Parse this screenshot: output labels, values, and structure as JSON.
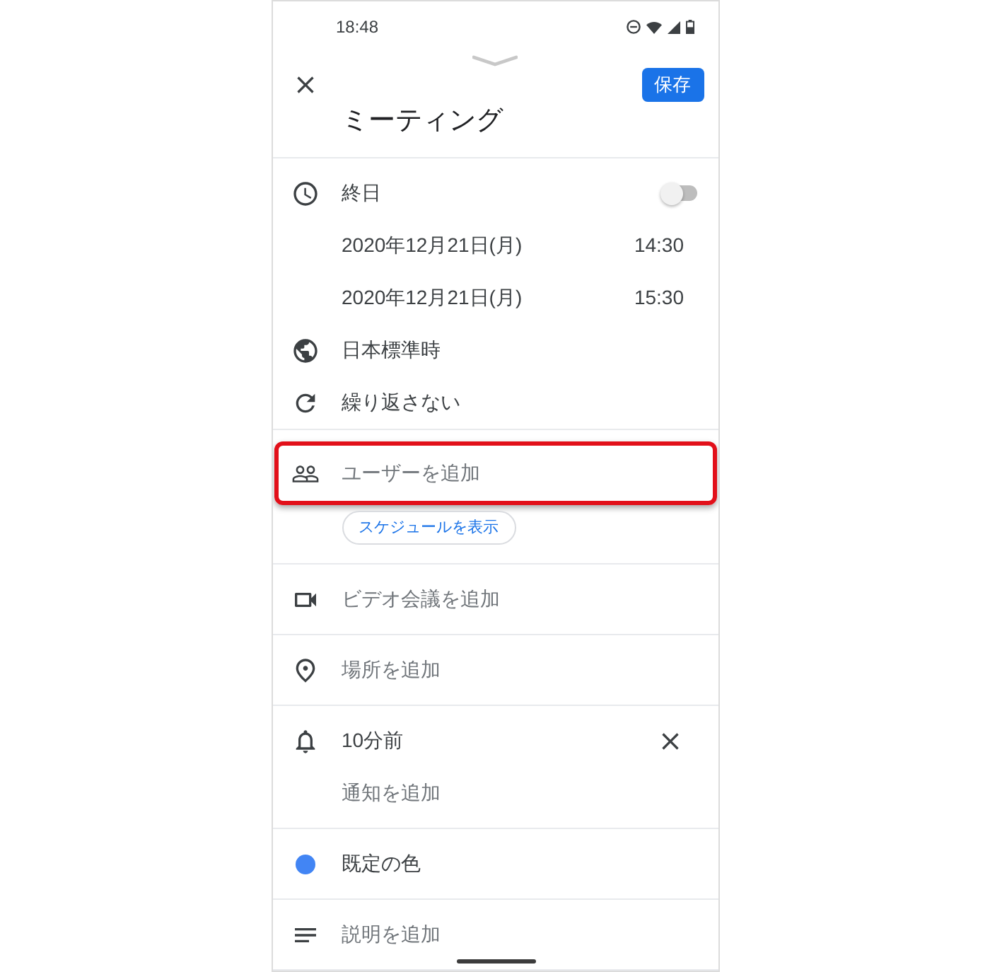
{
  "status_bar": {
    "time": "18:48"
  },
  "header": {
    "save_button": "保存",
    "title": "ミーティング"
  },
  "sections": [
    {
      "rows": [
        {
          "kind": "all_day",
          "label": "終日",
          "on": false,
          "highlighted": false
        },
        {
          "kind": "start",
          "date": "2020年12月21日(月)",
          "time": "14:30",
          "highlighted": false
        },
        {
          "kind": "end",
          "date": "2020年12月21日(月)",
          "time": "15:30",
          "highlighted": false
        },
        {
          "kind": "timezone",
          "label": "日本標準時",
          "highlighted": false
        },
        {
          "kind": "repeat",
          "label": "繰り返さない",
          "highlighted": false
        }
      ]
    },
    {
      "rows": [
        {
          "kind": "guests",
          "label": "ユーザーを追加",
          "highlighted": true
        },
        {
          "kind": "chip",
          "label": "スケジュールを表示",
          "highlighted": false
        }
      ]
    },
    {
      "rows": [
        {
          "kind": "video",
          "label": "ビデオ会議を追加",
          "highlighted": false
        }
      ]
    },
    {
      "rows": [
        {
          "kind": "location",
          "label": "場所を追加",
          "highlighted": false
        }
      ]
    },
    {
      "rows": [
        {
          "kind": "reminder",
          "label": "10分前",
          "highlighted": false
        },
        {
          "kind": "add_reminder",
          "label": "通知を追加",
          "highlighted": false
        }
      ]
    },
    {
      "rows": [
        {
          "kind": "color",
          "label": "既定の色",
          "color": "#4285f4",
          "highlighted": false
        }
      ]
    },
    {
      "rows": [
        {
          "kind": "description",
          "label": "説明を追加",
          "highlighted": false
        }
      ]
    }
  ]
}
